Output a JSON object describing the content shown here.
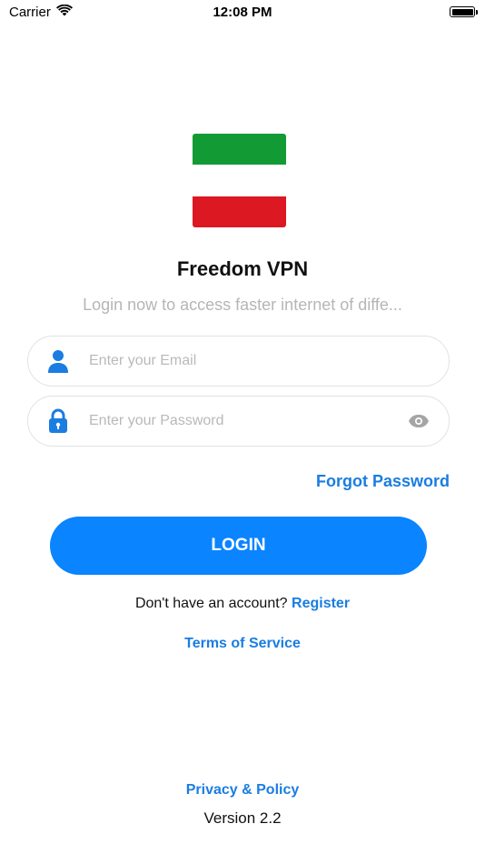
{
  "status_bar": {
    "carrier": "Carrier",
    "time": "12:08 PM"
  },
  "app": {
    "title": "Freedom VPN",
    "subtitle": "Login now to access faster internet of diffe..."
  },
  "form": {
    "email_placeholder": "Enter your Email",
    "email_value": "",
    "password_placeholder": "Enter your Password",
    "password_value": "",
    "forgot_label": "Forgot Password",
    "login_label": "LOGIN"
  },
  "footer": {
    "account_prompt": "Don't have an account?",
    "register_label": "Register",
    "terms_label": "Terms of Service",
    "privacy_label": "Privacy & Policy",
    "version": "Version 2.2"
  },
  "colors": {
    "accent": "#0a84ff",
    "link": "#1a7de1",
    "flag_green": "#129a34",
    "flag_white": "#ffffff",
    "flag_red": "#dc1822"
  },
  "icons": {
    "wifi": "wifi-icon",
    "battery": "battery-icon",
    "user": "user-icon",
    "lock": "lock-icon",
    "eye": "eye-icon"
  }
}
